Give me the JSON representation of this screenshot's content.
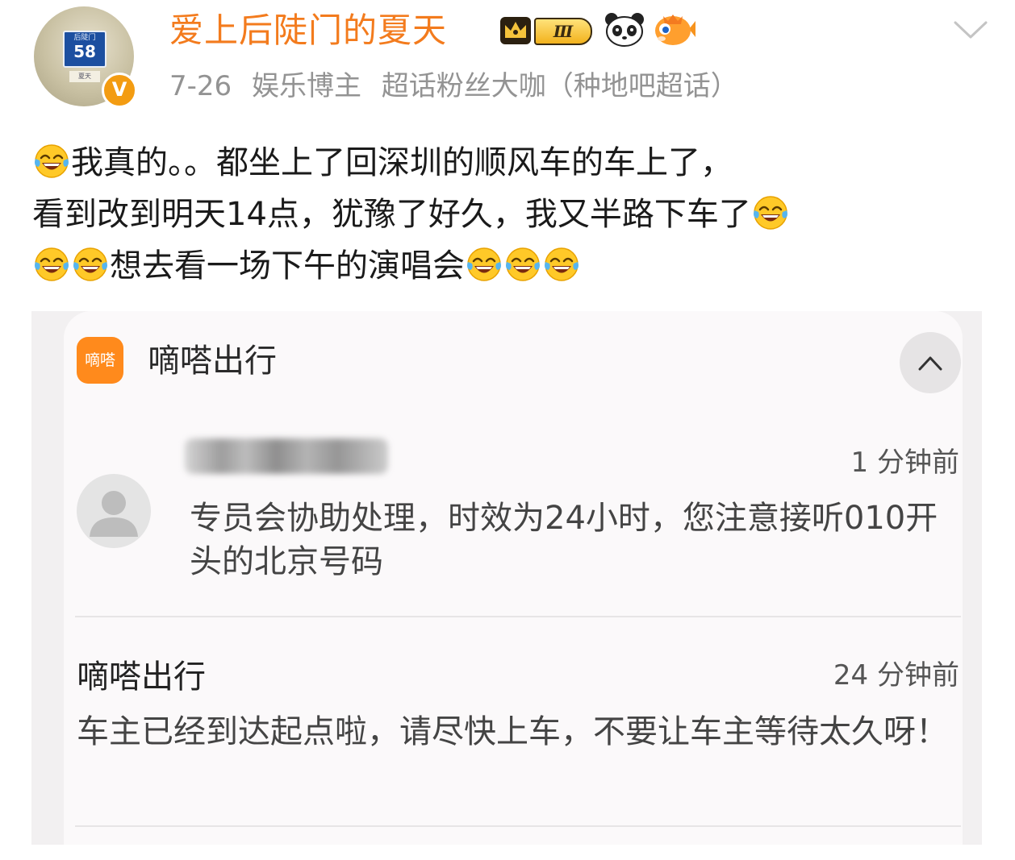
{
  "post": {
    "author": {
      "username": "爱上后陡门的夏天",
      "avatar_plate_small": "后陡门",
      "avatar_plate_number": "58",
      "avatar_sticker": "夏天",
      "verified_mark": "V",
      "level_badge": "Ⅲ",
      "badges": [
        "crown-icon",
        "level-badge",
        "panda-icon",
        "fish-icon"
      ]
    },
    "meta": {
      "date": "7-26",
      "role": "娱乐博主",
      "supertopic": "超话粉丝大咖（种地吧超话）"
    },
    "content_lines": [
      [
        "[laugh]",
        "我真的。。都坐上了回深圳的顺风车的车上了，"
      ],
      [
        "看到改到明天14点，犹豫了好久，我又半路下车了",
        "[laugh]"
      ],
      [
        "[laugh]",
        "[laugh]",
        "想去看一场下午的演唱会",
        "[laugh]",
        "[laugh]",
        "[laugh]"
      ]
    ]
  },
  "screenshot": {
    "app_icon_text": "嘀嗒",
    "app_name": "嘀嗒出行",
    "notification_1": {
      "sender": "",
      "time": "1 分钟前",
      "message": "专员会协助处理，时效为24小时，您注意接听010开头的北京号码"
    },
    "notification_2": {
      "title": "嘀嗒出行",
      "time": "24 分钟前",
      "message": "车主已经到达起点啦，请尽快上车，不要让车主等待太久呀！"
    }
  },
  "colors": {
    "username": "#f37b1d",
    "meta": "#939393",
    "app_icon": "#ff8a1c",
    "verified_badge": "#f39c12"
  }
}
